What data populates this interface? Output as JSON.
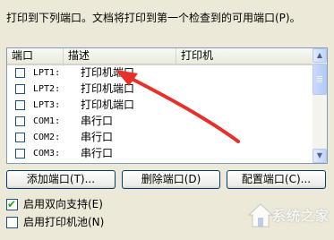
{
  "instruction": "打印到下列端口。文档将打印到第一个检查到的可用端口(P)。",
  "columns": [
    "端口",
    "描述",
    "打印机"
  ],
  "ports": [
    {
      "port": "LPT1:",
      "description": "打印机端口",
      "printer": "",
      "checked": false
    },
    {
      "port": "LPT2:",
      "description": "打印机端口",
      "printer": "",
      "checked": false
    },
    {
      "port": "LPT3:",
      "description": "打印机端口",
      "printer": "",
      "checked": false
    },
    {
      "port": "COM1:",
      "description": "串行口",
      "printer": "",
      "checked": false
    },
    {
      "port": "COM2:",
      "description": "串行口",
      "printer": "",
      "checked": false
    },
    {
      "port": "COM3:",
      "description": "串行口",
      "printer": "",
      "checked": false
    }
  ],
  "buttons": {
    "add": "添加端口(T)...",
    "delete": "删除端口(D)",
    "configure": "配置端口(C)..."
  },
  "options": {
    "bidi": {
      "label": "启用双向支持(E)",
      "checked": true
    },
    "pool": {
      "label": "启用打印机池(N)",
      "checked": false
    }
  },
  "watermark": "系统之家",
  "colors": {
    "arrow": "#e8302a",
    "check": "#21a121"
  },
  "icons": {
    "watermark_logo": "house-logo-icon"
  }
}
